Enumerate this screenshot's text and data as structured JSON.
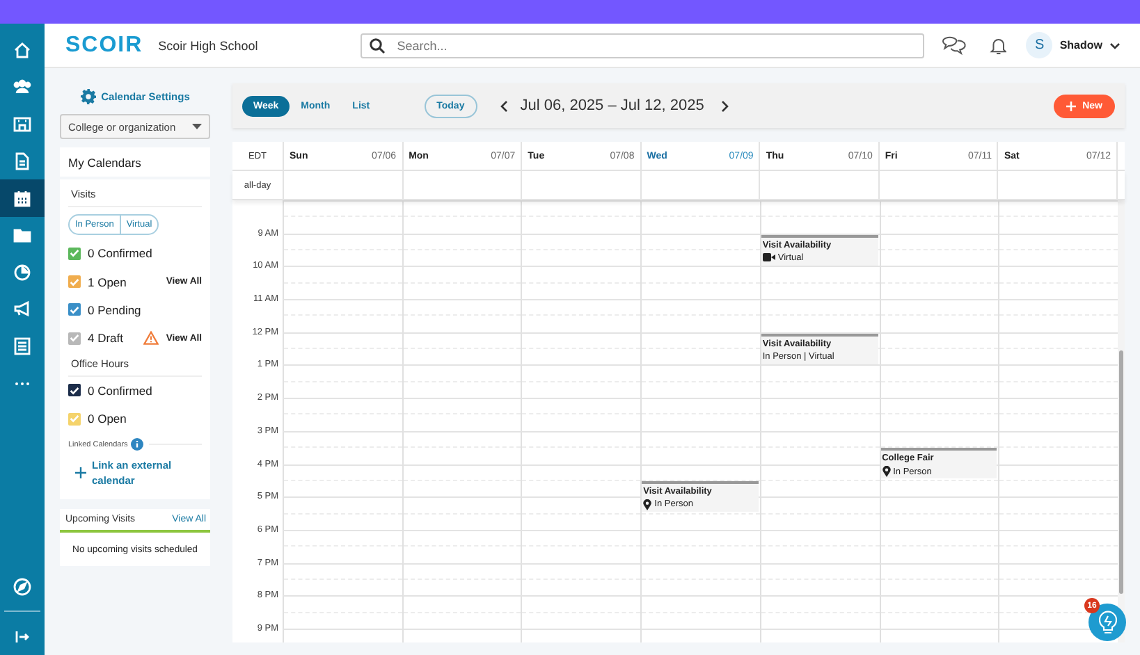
{
  "nav": [
    {
      "selected": false
    },
    {
      "selected": false
    },
    {
      "selected": false
    },
    {
      "selected": false
    },
    {
      "selected": true
    },
    {
      "selected": false
    },
    {
      "selected": false
    },
    {
      "selected": false
    },
    {
      "selected": false
    },
    {
      "selected": false
    }
  ],
  "header": {
    "logo": "SCOIR",
    "school": "Scoir High School",
    "search": {
      "placeholder": "Search..."
    },
    "user": {
      "initial": "S",
      "name": "Shadow"
    }
  },
  "sidebar": {
    "settings": "Calendar Settings",
    "filter": "College or organization",
    "my_calendars": "My Calendars",
    "visits_title": "Visits",
    "visit_modes": [
      {
        "label": "In Person",
        "selected": false
      },
      {
        "label": "Virtual",
        "selected": false
      }
    ],
    "visits": [
      {
        "label": "0 Confirmed",
        "checked": true,
        "color": "#5cb85c"
      },
      {
        "label": "1 Open",
        "checked": true,
        "color": "#f0ad4e",
        "action": "View All"
      },
      {
        "label": "0 Pending",
        "checked": true,
        "color": "#3a8fc7"
      },
      {
        "label": "4 Draft",
        "checked": true,
        "color": "#b8b8b8",
        "warning": true,
        "action": "View All"
      }
    ],
    "office_title": "Office Hours",
    "office": [
      {
        "label": "0 Confirmed",
        "checked": true,
        "color": "#1c2d4a"
      },
      {
        "label": "0 Open",
        "checked": true,
        "color": "#f5d36b"
      }
    ],
    "linked_title": "Linked Calendars",
    "link_action": "Link an external calendar",
    "upcoming": {
      "title": "Upcoming Visits",
      "action": "View All",
      "empty": "No upcoming visits scheduled"
    }
  },
  "toolbar": {
    "views": [
      {
        "label": "Week",
        "selected": true
      },
      {
        "label": "Month",
        "selected": false
      },
      {
        "label": "List",
        "selected": false
      }
    ],
    "today": "Today",
    "range_start": "Jul 06, 2025",
    "range_sep": "–",
    "range_end": "Jul 12, 2025",
    "new": "New"
  },
  "calendar": {
    "timezone": "EDT",
    "allday": "all-day",
    "days": [
      {
        "name": "Sun",
        "date": "07/06",
        "today": false
      },
      {
        "name": "Mon",
        "date": "07/07",
        "today": false
      },
      {
        "name": "Tue",
        "date": "07/08",
        "today": false
      },
      {
        "name": "Wed",
        "date": "07/09",
        "today": true
      },
      {
        "name": "Thu",
        "date": "07/10",
        "today": false
      },
      {
        "name": "Fri",
        "date": "07/11",
        "today": false
      },
      {
        "name": "Sat",
        "date": "07/12",
        "today": false
      }
    ],
    "hours": [
      {
        "label": "9 AM",
        "cells": [
          {
            "kind": "empty"
          },
          {
            "kind": "empty"
          },
          {
            "kind": "empty"
          },
          {
            "kind": "empty"
          },
          {
            "kind": "video",
            "title": "Visit Availability",
            "detail": "Virtual",
            "half": false
          },
          {
            "kind": "empty"
          },
          {
            "kind": "empty"
          }
        ]
      },
      {
        "label": "10 AM"
      },
      {
        "label": "11 AM"
      },
      {
        "label": "12 PM",
        "cells": [
          {
            "kind": "empty"
          },
          {
            "kind": "empty"
          },
          {
            "kind": "empty"
          },
          {
            "kind": "empty"
          },
          {
            "kind": "plain",
            "title": "Visit Availability",
            "detail": "In Person | Virtual",
            "half": false
          },
          {
            "kind": "empty"
          },
          {
            "kind": "empty"
          }
        ]
      },
      {
        "label": "1 PM"
      },
      {
        "label": "2 PM"
      },
      {
        "label": "3 PM",
        "cells": [
          {
            "kind": "empty"
          },
          {
            "kind": "empty"
          },
          {
            "kind": "empty"
          },
          {
            "kind": "empty"
          },
          {
            "kind": "empty"
          },
          {
            "kind": "pin",
            "title": "College Fair",
            "detail": "In Person",
            "half": true
          },
          {
            "kind": "empty"
          }
        ]
      },
      {
        "label": "4 PM",
        "cells": [
          {
            "kind": "empty"
          },
          {
            "kind": "empty"
          },
          {
            "kind": "empty"
          },
          {
            "kind": "pin",
            "title": "Visit Availability",
            "detail": "In Person",
            "half": true
          },
          {
            "kind": "empty"
          },
          {
            "kind": "empty"
          },
          {
            "kind": "empty"
          }
        ]
      },
      {
        "label": "5 PM"
      },
      {
        "label": "6 PM"
      },
      {
        "label": "7 PM"
      },
      {
        "label": "8 PM"
      },
      {
        "label": "9 PM"
      }
    ]
  },
  "help": {
    "badge": "16"
  }
}
